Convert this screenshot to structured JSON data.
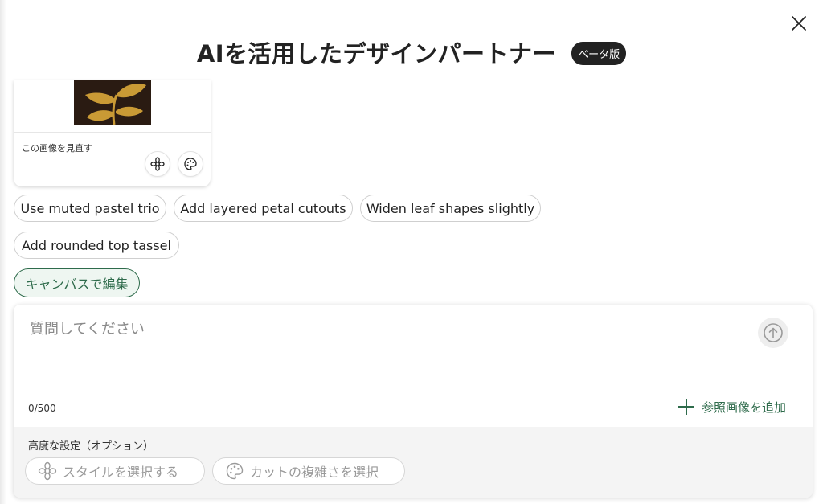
{
  "header": {
    "title": "AIを活用したデザインパートナー",
    "badge": "ベータ版"
  },
  "preview_card": {
    "label": "この画像を見直す"
  },
  "suggestions": [
    "Use muted pastel trio",
    "Add layered petal cutouts",
    "Widen leaf shapes slightly",
    "Add rounded top tassel"
  ],
  "edit_canvas_label": "キャンバスで編集",
  "prompt": {
    "placeholder": "質問してください",
    "value": "",
    "counter": "0/500",
    "add_reference_label": "参照画像を追加"
  },
  "advanced": {
    "title": "高度な設定（オプション）",
    "style_placeholder": "スタイルを選択する",
    "complexity_placeholder": "カットの複雑さを選択"
  },
  "colors": {
    "accent": "#2e6b4b",
    "badge_bg": "#222222",
    "thumb_bg": "#2a1b12",
    "leaf_gold": "#c99a35"
  }
}
